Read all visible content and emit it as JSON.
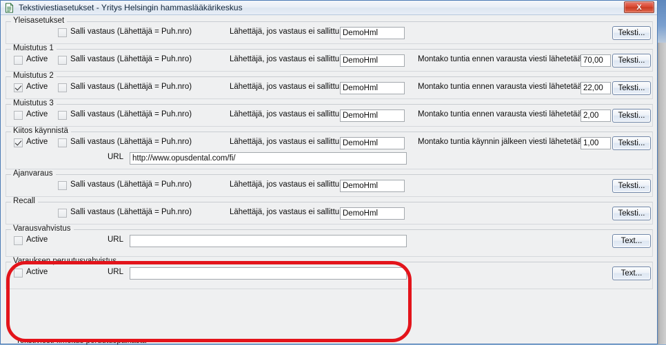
{
  "window": {
    "title": "Tekstiviestiasetukset - Yritys Helsingin hammaslääkärikeskus",
    "icon": "document-icon",
    "close_label": "X",
    "accent_border": "#4a7ab5",
    "annotation_color": "#e3141b"
  },
  "common": {
    "allow_reply_label": "Salli vastaus (Lähettäjä = Puh.nro)",
    "sender_label": "Lähettäjä, jos vastaus ei sallittu",
    "sender_value": "DemoHml",
    "active_label": "Active",
    "url_label": "URL",
    "text_button_fi": "Teksti...",
    "text_button_en": "Text...",
    "hours_before_label": "Montako tuntia ennen varausta viesti lähetetään",
    "hours_after_label": "Montako tuntia käynnin jälkeen viesti lähetetään"
  },
  "sections": [
    {
      "key": "yleisasetukset",
      "title": "Yleisasetukset",
      "has_active": false,
      "active_checked": false,
      "has_allow_reply": true,
      "allow_reply_checked": false,
      "has_sender": true,
      "sender_value": "DemoHml",
      "has_hours": false,
      "hours_label": "",
      "hours_value": "",
      "has_url": false,
      "url_value": "",
      "button_label": "Teksti..."
    },
    {
      "key": "muistutus-1",
      "title": "Muistutus 1",
      "has_active": true,
      "active_checked": false,
      "has_allow_reply": true,
      "allow_reply_checked": false,
      "has_sender": true,
      "sender_value": "DemoHml",
      "has_hours": true,
      "hours_label": "Montako tuntia ennen varausta viesti lähetetään",
      "hours_value": "70,00",
      "has_url": false,
      "url_value": "",
      "button_label": "Teksti..."
    },
    {
      "key": "muistutus-2",
      "title": "Muistutus 2",
      "has_active": true,
      "active_checked": true,
      "has_allow_reply": true,
      "allow_reply_checked": false,
      "has_sender": true,
      "sender_value": "DemoHml",
      "has_hours": true,
      "hours_label": "Montako tuntia ennen varausta viesti lähetetään",
      "hours_value": "22,00",
      "has_url": false,
      "url_value": "",
      "button_label": "Teksti..."
    },
    {
      "key": "muistutus-3",
      "title": "Muistutus 3",
      "has_active": true,
      "active_checked": false,
      "has_allow_reply": true,
      "allow_reply_checked": false,
      "has_sender": true,
      "sender_value": "DemoHml",
      "has_hours": true,
      "hours_label": "Montako tuntia ennen varausta viesti lähetetään",
      "hours_value": "2,00",
      "has_url": false,
      "url_value": "",
      "button_label": "Teksti..."
    },
    {
      "key": "kiitos-kaynnista",
      "title": "Kiitos käynnistä",
      "has_active": true,
      "active_checked": true,
      "has_allow_reply": true,
      "allow_reply_checked": false,
      "has_sender": true,
      "sender_value": "DemoHml",
      "has_hours": true,
      "hours_label": "Montako tuntia käynnin jälkeen viesti lähetetään",
      "hours_value": "1,00",
      "has_url": true,
      "url_value": "http://www.opusdental.com/fi/",
      "button_label": "Teksti..."
    },
    {
      "key": "ajanvaraus",
      "title": "Ajanvaraus",
      "has_active": false,
      "active_checked": false,
      "has_allow_reply": true,
      "allow_reply_checked": false,
      "has_sender": true,
      "sender_value": "DemoHml",
      "has_hours": false,
      "hours_label": "",
      "hours_value": "",
      "has_url": false,
      "url_value": "",
      "button_label": "Teksti..."
    },
    {
      "key": "recall",
      "title": "Recall",
      "has_active": false,
      "active_checked": false,
      "has_allow_reply": true,
      "allow_reply_checked": false,
      "has_sender": true,
      "sender_value": "DemoHml",
      "has_hours": false,
      "hours_label": "",
      "hours_value": "",
      "has_url": false,
      "url_value": "",
      "button_label": "Teksti..."
    },
    {
      "key": "varausvahvistus",
      "title": "Varausvahvistus",
      "has_active": true,
      "active_checked": false,
      "has_allow_reply": false,
      "allow_reply_checked": false,
      "has_sender": false,
      "sender_value": "",
      "has_hours": false,
      "hours_label": "",
      "hours_value": "",
      "has_url": true,
      "url_value": "",
      "button_label": "Text..."
    },
    {
      "key": "varauksen-peruutusvahvistus",
      "title": "Varauksen peruutusvahvistus",
      "has_active": true,
      "active_checked": false,
      "has_allow_reply": false,
      "allow_reply_checked": false,
      "has_sender": false,
      "sender_value": "",
      "has_hours": false,
      "hours_label": "",
      "hours_value": "",
      "has_url": true,
      "url_value": "",
      "button_label": "Text..."
    }
  ],
  "cutoff_section": {
    "title": "Tekstiviesti Ilmoitus peruutuspaikasta"
  }
}
